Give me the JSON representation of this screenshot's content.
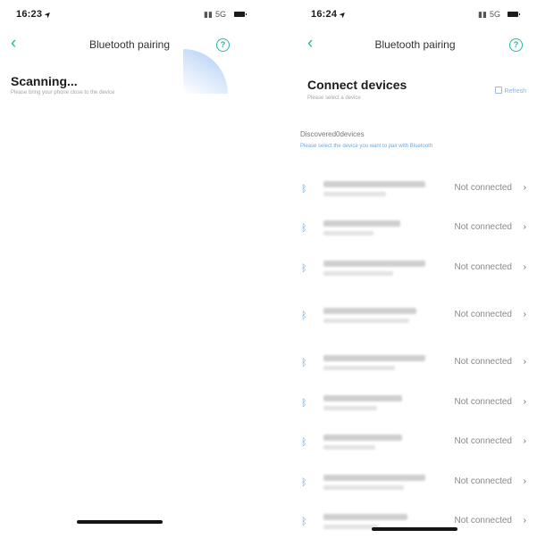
{
  "left_screen": {
    "status": {
      "time": "16:23",
      "network": "5G"
    },
    "nav": {
      "title": "Bluetooth pairing"
    },
    "scanning": {
      "title": "Scanning...",
      "subtitle": "Please bring your phone close to the device"
    }
  },
  "right_screen": {
    "status": {
      "time": "16:24",
      "network": "5G"
    },
    "nav": {
      "title": "Bluetooth pairing"
    },
    "connect": {
      "title": "Connect devices",
      "subtitle": "Please select a device",
      "refresh_label": "Refresh"
    },
    "discovered": {
      "title": "Discovered0devices",
      "subtitle": "Please select the device you want to pair with Bluetooth"
    },
    "devices": [
      {
        "status": "Not connected"
      },
      {
        "status": "Not connected"
      },
      {
        "status": "Not connected"
      },
      {
        "status": "Not connected"
      },
      {
        "status": "Not connected"
      },
      {
        "status": "Not connected"
      },
      {
        "status": "Not connected"
      },
      {
        "status": "Not connected"
      },
      {
        "status": "Not connected"
      }
    ]
  },
  "icons": {
    "back": "chevron-left-icon",
    "help": "question-circle-icon",
    "bluetooth": "bluetooth-icon",
    "row_arrow": "chevron-right-icon",
    "refresh": "refresh-icon",
    "battery": "battery-icon",
    "location": "location-arrow-icon"
  },
  "colors": {
    "accent": "#1fb8a3",
    "bluetooth": "#5ba6e6",
    "link": "#6ea8df"
  }
}
